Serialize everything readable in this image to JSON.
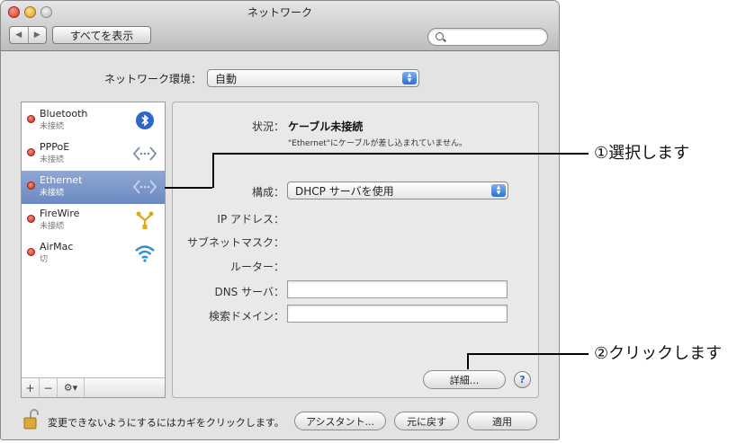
{
  "window": {
    "title": "ネットワーク"
  },
  "toolbar": {
    "back_glyph": "◀",
    "forward_glyph": "▶",
    "show_all_label": "すべてを表示",
    "search_value": ""
  },
  "location": {
    "label": "ネットワーク環境：",
    "value": "自動"
  },
  "services": [
    {
      "name": "Bluetooth",
      "status": "未接続",
      "icon": "bluetooth-icon"
    },
    {
      "name": "PPPoE",
      "status": "未接続",
      "icon": "ethernet-icon"
    },
    {
      "name": "Ethernet",
      "status": "未接続",
      "icon": "ethernet-icon",
      "selected": true
    },
    {
      "name": "FireWire",
      "status": "未接続",
      "icon": "firewire-icon"
    },
    {
      "name": "AirMac",
      "status": "切",
      "icon": "wifi-icon"
    }
  ],
  "sidebar_footer": {
    "add": "+",
    "remove": "−",
    "action": "⚙▾"
  },
  "detail": {
    "status_label": "状況：",
    "status_value": "ケーブル未接続",
    "status_description": "\"Ethernet\"にケーブルが差し込まれていません。",
    "config_label": "構成：",
    "config_value": "DHCP サーバを使用",
    "ip_label": "IP アドレス：",
    "subnet_label": "サブネットマスク：",
    "router_label": "ルーター：",
    "dns_label": "DNS サーバ：",
    "dns_value": "",
    "search_domain_label": "検索ドメイン：",
    "search_domain_value": "",
    "advanced_label": "詳細...",
    "help_label": "?"
  },
  "bottom": {
    "lock_text": "変更できないようにするにはカギをクリックします。",
    "assistant_label": "アシスタント...",
    "revert_label": "元に戻す",
    "apply_label": "適用"
  },
  "annotations": {
    "select": "①選択します",
    "click": "②クリックします"
  },
  "colors": {
    "selection": "#7590c7",
    "accent_blue": "#2a6fd6",
    "status_red": "#d3301c"
  }
}
